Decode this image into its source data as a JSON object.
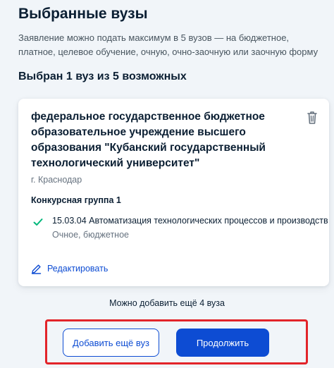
{
  "header": {
    "title": "Выбранные вузы",
    "description": "Заявление можно подать максимум в 5 вузов — на бюджетное, платное, целевое обучение, очную, очно-заочную или заочную форму"
  },
  "selection": {
    "count_text": "Выбран 1 вуз из 5 возможных"
  },
  "university_card": {
    "name": "федеральное государственное бюджетное образовательное учреждение высшего образования \"Кубанский государственный технологический университет\"",
    "city": "г. Краснодар",
    "group_title": "Конкурсная группа 1",
    "program": {
      "name": "15.03.04 Автоматизация технологических процессов и производств",
      "form": "Очное, бюджетное"
    },
    "edit_label": "Редактировать",
    "delete_icon": "trash-icon",
    "check_icon": "check-icon",
    "edit_icon": "pencil-icon"
  },
  "footer": {
    "hint": "Можно добавить ещё 4 вуза",
    "add_button": "Добавить ещё вуз",
    "continue_button": "Продолжить"
  },
  "colors": {
    "primary": "#0d4cd3",
    "success": "#00b77a",
    "highlight": "#e2242a",
    "background": "#f1f5f9"
  }
}
